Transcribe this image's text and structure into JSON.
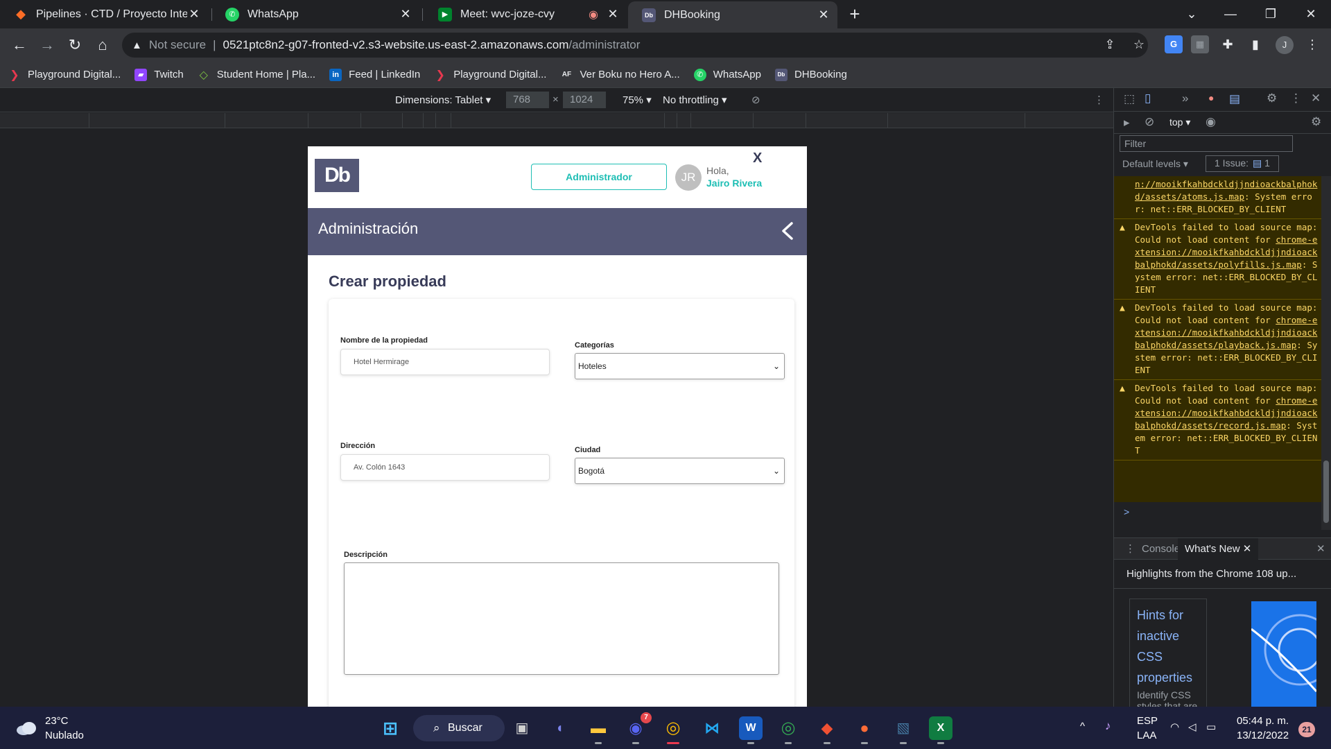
{
  "browser": {
    "tabs": [
      {
        "label": "Pipelines · CTD / Proyecto Integr…",
        "icon": "gitlab-icon"
      },
      {
        "label": "WhatsApp",
        "icon": "whatsapp-icon"
      },
      {
        "label": "Meet: wvc-joze-cvy",
        "icon": "meet-icon"
      },
      {
        "label": "DHBooking",
        "icon": "dh-icon"
      }
    ],
    "omnibox": {
      "security": "Not secure",
      "host": "0521ptc8n2-g07-fronted-v2.s3-website.us-east-2.amazonaws.com",
      "path": "/administrator"
    },
    "profile_initial": "J",
    "bookmarks": [
      "Playground Digital...",
      "Twitch",
      "Student Home | Pla...",
      "Feed | LinkedIn",
      "Playground Digital...",
      "Ver Boku no Hero A...",
      "WhatsApp",
      "DHBooking"
    ]
  },
  "device_toolbar": {
    "dimensions_label": "Dimensions: Tablet",
    "width": "768",
    "times": "×",
    "height": "1024",
    "zoom": "75%",
    "throttling": "No throttling"
  },
  "site": {
    "logo": "Db",
    "admin_button": "Administrador",
    "avatar_initials": "JR",
    "greeting": "Hola,",
    "user_name": "Jairo Rivera",
    "close": "X",
    "admin_bar_title": "Administración",
    "form_title": "Crear propiedad",
    "fields": {
      "name_label": "Nombre de la propiedad",
      "name_value": "Hotel Hermirage",
      "category_label": "Categorías",
      "category_value": "Hoteles",
      "address_label": "Dirección",
      "address_value": "Av. Colón 1643",
      "city_label": "Ciudad",
      "city_value": "Bogotá",
      "description_label": "Descripción"
    }
  },
  "devtools": {
    "context": "top",
    "filter_placeholder": "Filter",
    "levels": "Default levels",
    "issues": "1 Issue:",
    "issues_count": "1",
    "logs": {
      "first_tail_link": "n://mooikfkahbdckldjjndioackbalphokd/assets/atoms.js.map",
      "first_tail_rest": ": System error: net::ERR_BLOCKED_BY_CLIENT",
      "msg_prefix": "DevTools failed to load source map: Could not load content for ",
      "msg_suffix": ": System error: net::ERR_BLOCKED_BY_CLIENT",
      "link2": "chrome-extension://mooikfkahbdckldjjndioackbalphokd/assets/polyfills.js.map",
      "link3": "chrome-extension://mooikfkahbdckldjjndioackbalphokd/assets/playback.js.map",
      "link4": "chrome-extension://mooikfkahbdckldjjndioackbalphokd/assets/record.js.map"
    },
    "prompt": ">",
    "drawer_tabs": [
      "Console",
      "What's New"
    ],
    "whatsnew_heading": "Highlights from the Chrome 108 up...",
    "hint_title": "Hints for inactive CSS properties",
    "hint_desc": "Identify CSS styles that are entirely..."
  },
  "taskbar": {
    "weather_temp": "23°C",
    "weather_desc": "Nublado",
    "search_label": "Buscar",
    "discord_badge": "7",
    "lang_top": "ESP",
    "lang_bottom": "LAA",
    "time": "05:44 p. m.",
    "date": "13/12/2022",
    "notifications": "21"
  }
}
